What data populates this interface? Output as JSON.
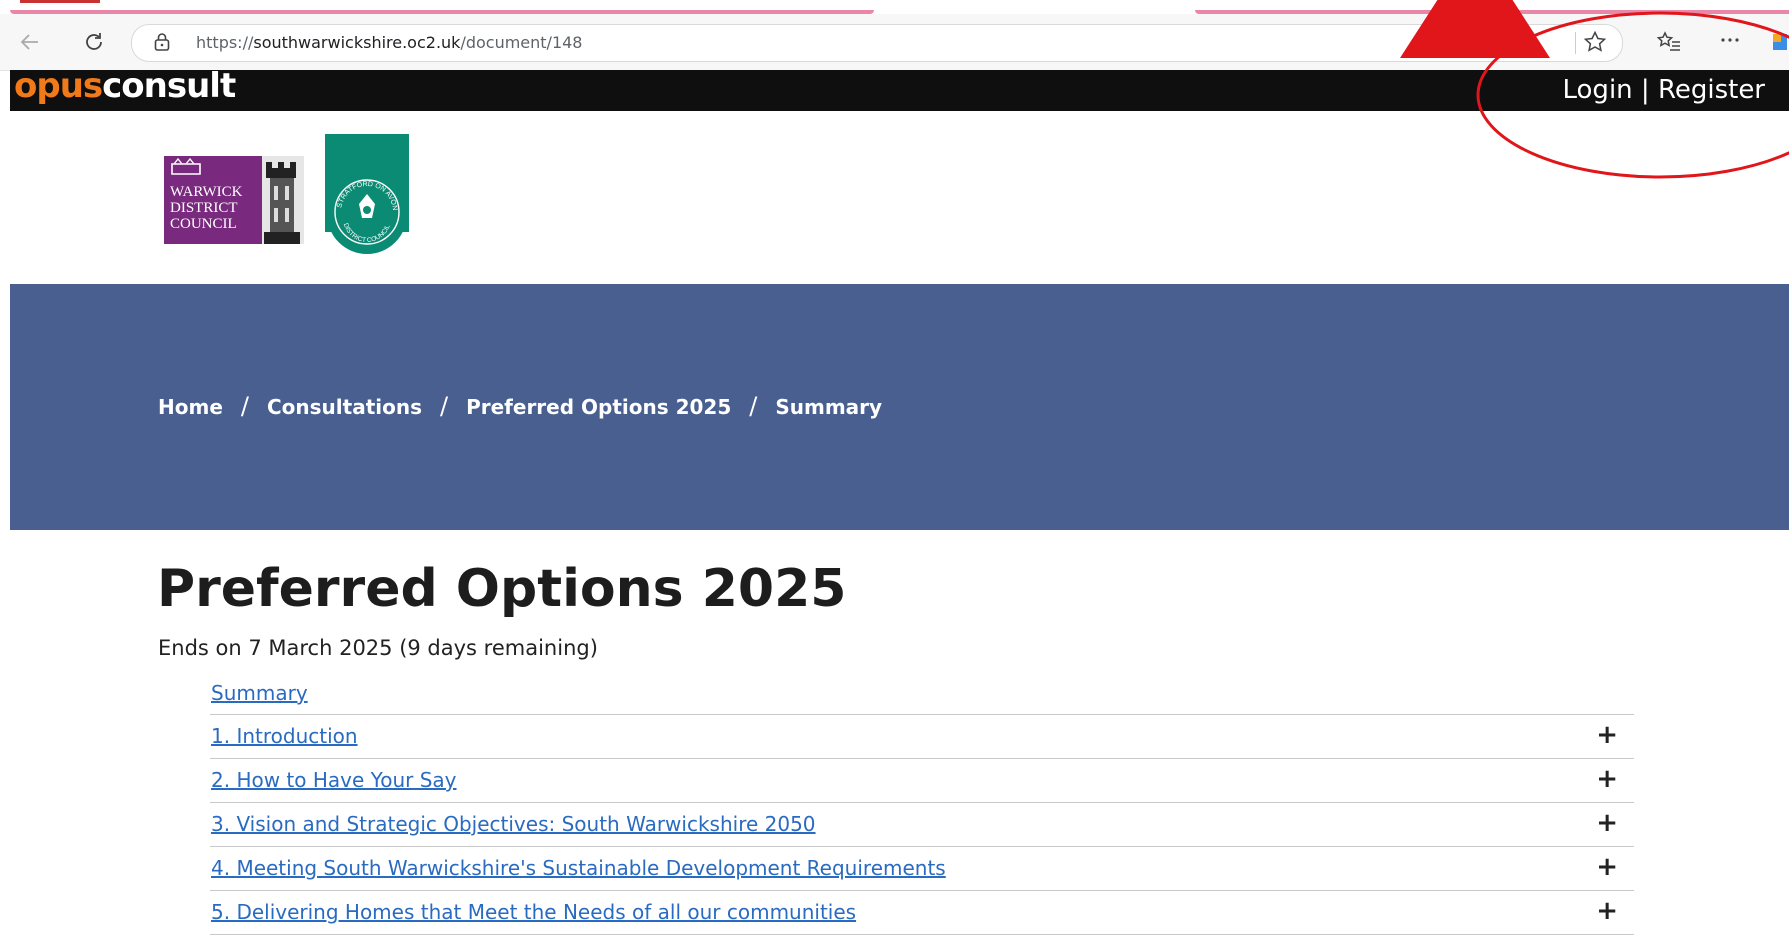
{
  "browser": {
    "url_prefix": "https://",
    "url_host": "southwarwickshire.oc2.uk",
    "url_path": "/document/148",
    "icons": [
      "back-icon",
      "reload-icon",
      "lock-icon",
      "favorite-star-icon",
      "favorites-list-icon",
      "more-icon"
    ]
  },
  "header": {
    "logo_part1": "opus",
    "logo_part2": "consult",
    "login_label": "Login",
    "divider": "|",
    "register_label": "Register"
  },
  "councils": {
    "warwick_lines": [
      "WARWICK",
      "DISTRICT",
      "COUNCIL"
    ],
    "stratford_top": "STRATFORD ON AVON",
    "stratford_bottom": "DISTRICT COUNCIL"
  },
  "breadcrumb": [
    "Home",
    "Consultations",
    "Preferred Options 2025",
    "Summary"
  ],
  "page": {
    "title": "Preferred Options 2025",
    "deadline": "Ends on 7 March 2025 (9 days remaining)"
  },
  "toc": [
    {
      "label": "Summary",
      "expandable": false
    },
    {
      "label": "1. Introduction",
      "expandable": true
    },
    {
      "label": "2. How to Have Your Say",
      "expandable": true
    },
    {
      "label": "3. Vision and Strategic Objectives: South Warwickshire 2050",
      "expandable": true
    },
    {
      "label": "4. Meeting South Warwickshire's Sustainable Development Requirements",
      "expandable": true
    },
    {
      "label": "5. Delivering Homes that Meet the Needs of all our communities",
      "expandable": true
    }
  ],
  "expand_symbol": "+",
  "colors": {
    "hero": "#485f8f",
    "link": "#2a6bc2",
    "opus_orange": "#f07a1a",
    "annotation_red": "#e0161b",
    "warwick_purple": "#7a2a7e",
    "stratford_green": "#0b8a74"
  }
}
